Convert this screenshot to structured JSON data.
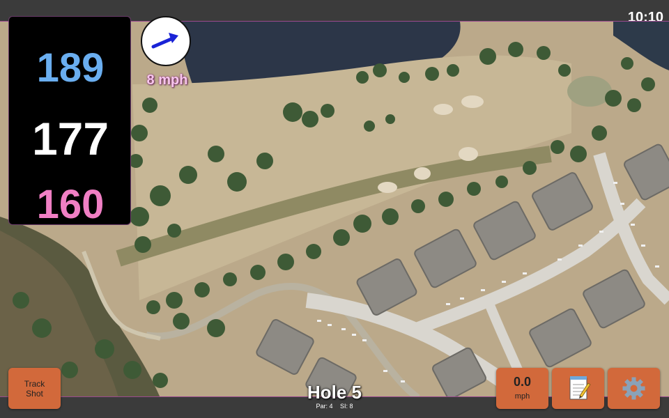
{
  "status_bar": {
    "time": "10:10"
  },
  "yardages": {
    "back": "189",
    "middle": "177",
    "front": "160"
  },
  "wind": {
    "speed": "8 mph",
    "direction_icon": "arrow-icon"
  },
  "buttons": {
    "track_shot_line1": "Track",
    "track_shot_line2": "Shot",
    "shot_speed_value": "0.0",
    "shot_speed_unit": "mph",
    "notes_icon": "notepad-icon",
    "settings_icon": "gear-icon"
  },
  "hole": {
    "title": "Hole 5",
    "par": "Par: 4",
    "stroke_index": "SI: 8"
  },
  "colors": {
    "back_yardage": "#6aaef0",
    "middle_yardage": "#ffffff",
    "front_yardage": "#f07fc4",
    "button": "#d2693b",
    "wind_arrow": "#1a23d6"
  }
}
